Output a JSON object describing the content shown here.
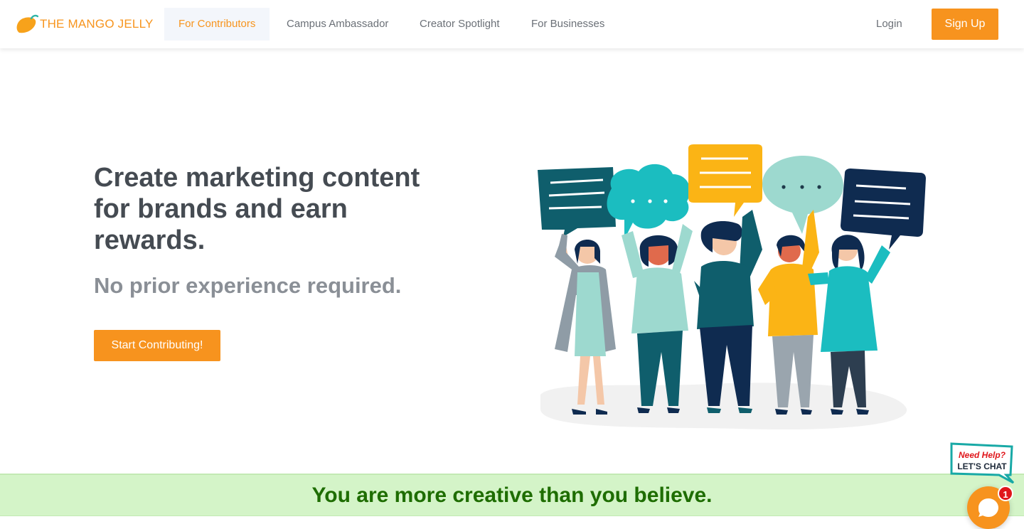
{
  "brand": {
    "name": "THE MANGO JELLY",
    "color": "#f7941d"
  },
  "nav": {
    "items": [
      {
        "label": "For Contributors",
        "active": true
      },
      {
        "label": "Campus Ambassador",
        "active": false
      },
      {
        "label": "Creator Spotlight",
        "active": false
      },
      {
        "label": "For Businesses",
        "active": false
      }
    ],
    "login_label": "Login",
    "signup_label": "Sign Up"
  },
  "hero": {
    "title": "Create marketing content for brands and earn rewards.",
    "subtitle": "No prior experience required.",
    "cta_label": "Start Contributing!"
  },
  "banner": {
    "text": "You are more creative than you believe."
  },
  "chat": {
    "label_line1": "Need Help?",
    "label_line2": "LET'S CHAT",
    "badge_count": "1"
  },
  "colors": {
    "accent": "#f7931e",
    "banner_bg": "#d4f4c8",
    "banner_text": "#1e6d00",
    "heading": "#454b52"
  }
}
